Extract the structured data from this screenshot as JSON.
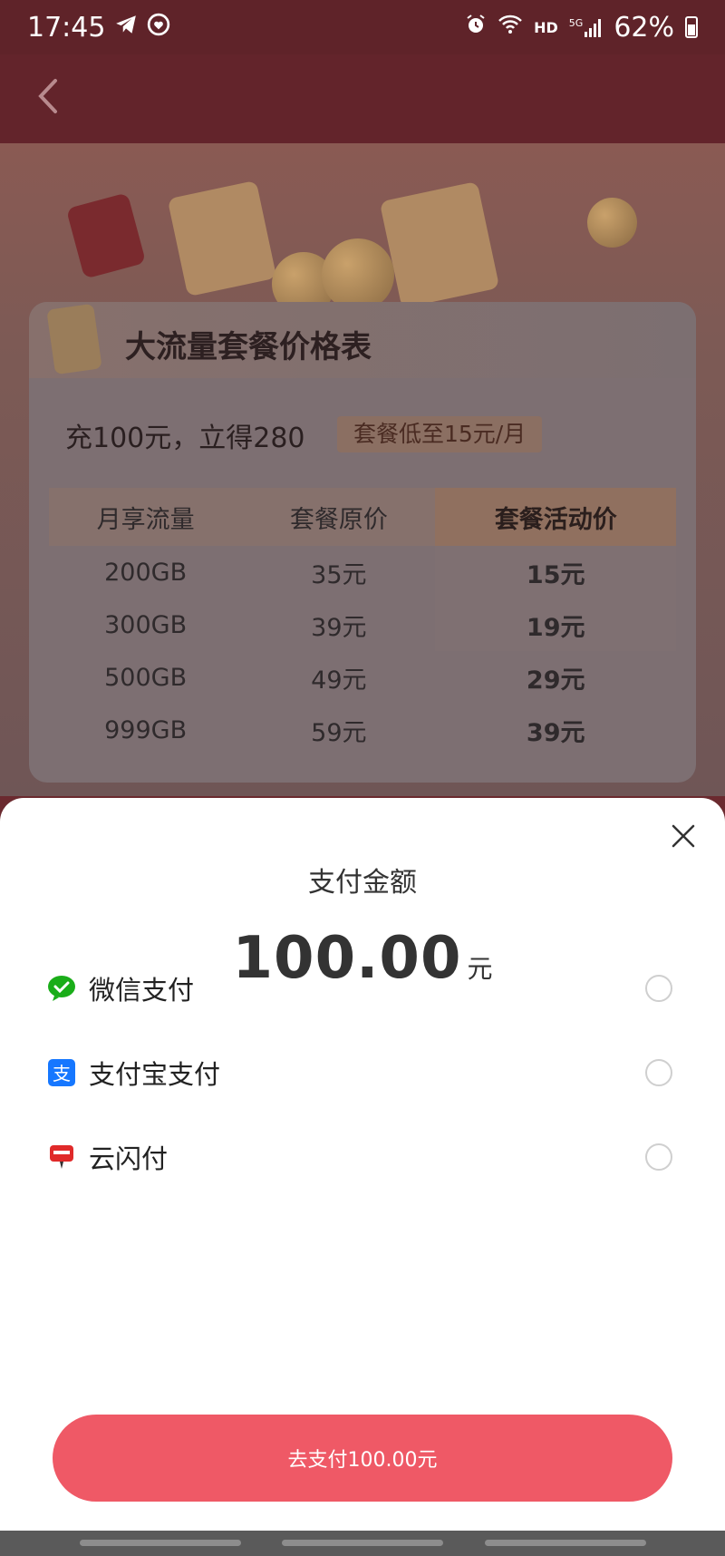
{
  "status_bar": {
    "time": "17:45",
    "network": "HD",
    "signal_label": "5G",
    "battery_percent": "62%"
  },
  "background": {
    "card_title": "大流量套餐价格表",
    "promo_text": "充100元，立得280",
    "promo_tag": "套餐低至15元/月",
    "table": {
      "headers": [
        "月享流量",
        "套餐原价",
        "套餐活动价"
      ],
      "rows": [
        [
          "200GB",
          "35元",
          "15元"
        ],
        [
          "300GB",
          "39元",
          "19元"
        ],
        [
          "500GB",
          "49元",
          "29元"
        ],
        [
          "999GB",
          "59元",
          "39元"
        ]
      ]
    }
  },
  "sheet": {
    "title": "支付金额",
    "amount": "100.00",
    "unit": "元",
    "methods": [
      {
        "label": "微信支付",
        "icon": "wechat-pay-icon",
        "color": "#1aad19"
      },
      {
        "label": "支付宝支付",
        "icon": "alipay-icon",
        "color": "#1677ff"
      },
      {
        "label": "云闪付",
        "icon": "unionpay-quickpass-icon",
        "color": "#e02a2a"
      }
    ],
    "pay_button": "去支付100.00元"
  },
  "colors": {
    "accent": "#ef5966",
    "header": "#63242b"
  }
}
